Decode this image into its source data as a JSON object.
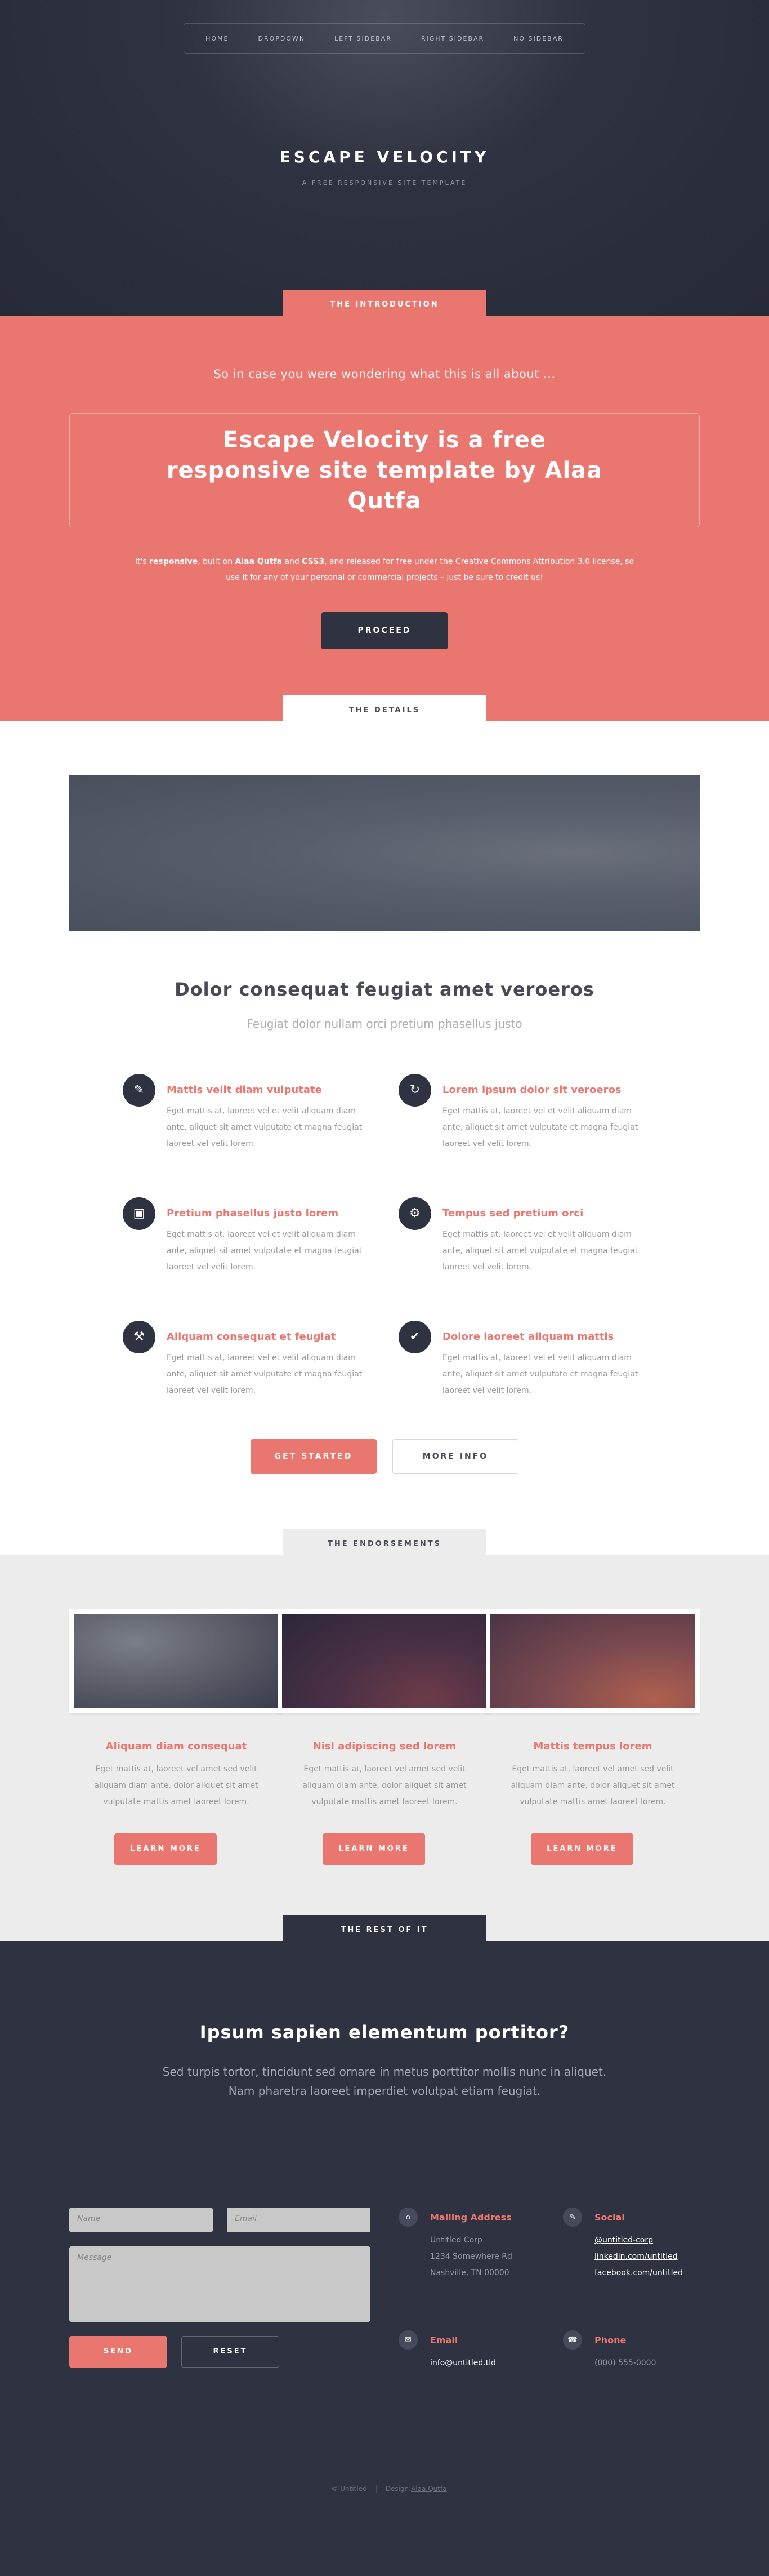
{
  "nav": {
    "items": [
      "HOME",
      "DROPDOWN",
      "LEFT SIDEBAR",
      "RIGHT SIDEBAR",
      "NO SIDEBAR"
    ]
  },
  "header": {
    "title": "ESCAPE VELOCITY",
    "tagline": "A FREE RESPONSIVE SITE TEMPLATE"
  },
  "intro": {
    "tab": "THE INTRODUCTION",
    "lead": "So in case you were wondering what this is all about ...",
    "headline": "Escape Velocity is a free responsive site template by Alaa Qutfa",
    "text": {
      "p1": "It's ",
      "b1": "responsive",
      "p2": ", built on ",
      "b2": "Alaa Qutfa",
      "p3": " and ",
      "b3": "CSS3",
      "p4": ", and released for free under the ",
      "link": "Creative Commons Attribution 3.0 license",
      "p5": ", so use it for any of your personal or commercial projects – just be sure to credit us!"
    },
    "button": "PROCEED"
  },
  "details": {
    "tab": "THE DETAILS",
    "title": "Dolor consequat feugiat amet veroeros",
    "subtitle": "Feugiat dolor nullam orci pretium phasellus justo",
    "features": [
      {
        "icon": "comment-icon",
        "title": "Mattis velit diam vulputate",
        "text": "Eget mattis at, laoreet vel et velit aliquam diam ante, aliquet sit amet vulputate et magna feugiat laoreet vel velit lorem."
      },
      {
        "icon": "refresh-icon",
        "title": "Lorem ipsum dolor sit veroeros",
        "text": "Eget mattis at, laoreet vel et velit aliquam diam ante, aliquet sit amet vulputate et magna feugiat laoreet vel velit lorem."
      },
      {
        "icon": "picture-icon",
        "title": "Pretium phasellus justo lorem",
        "text": "Eget mattis at, laoreet vel et velit aliquam diam ante, aliquet sit amet vulputate et magna feugiat laoreet vel velit lorem."
      },
      {
        "icon": "gear-icon",
        "title": "Tempus sed pretium orci",
        "text": "Eget mattis at, laoreet vel et velit aliquam diam ante, aliquet sit amet vulputate et magna feugiat laoreet vel velit lorem."
      },
      {
        "icon": "wrench-icon",
        "title": "Aliquam consequat et feugiat",
        "text": "Eget mattis at, laoreet vel et velit aliquam diam ante, aliquet sit amet vulputate et magna feugiat laoreet vel velit lorem."
      },
      {
        "icon": "check-icon",
        "title": "Dolore laoreet aliquam mattis",
        "text": "Eget mattis at, laoreet vel et velit aliquam diam ante, aliquet sit amet vulputate et magna feugiat laoreet vel velit lorem."
      }
    ],
    "btn_start": "GET STARTED",
    "btn_more": "MORE INFO"
  },
  "endorsements": {
    "tab": "THE ENDORSEMENTS",
    "cards": [
      {
        "title": "Aliquam diam consequat",
        "text": "Eget mattis at, laoreet vel amet sed velit aliquam diam ante, dolor aliquet sit amet vulputate mattis amet laoreet lorem.",
        "button": "LEARN MORE"
      },
      {
        "title": "Nisl adipiscing sed lorem",
        "text": "Eget mattis at, laoreet vel amet sed velit aliquam diam ante, dolor aliquet sit amet vulputate mattis amet laoreet lorem.",
        "button": "LEARN MORE"
      },
      {
        "title": "Mattis tempus lorem",
        "text": "Eget mattis at, laoreet vel amet sed velit aliquam diam ante, dolor aliquet sit amet vulputate mattis amet laoreet lorem.",
        "button": "LEARN MORE"
      }
    ]
  },
  "footer": {
    "tab": "THE REST OF IT",
    "title": "Ipsum sapien elementum portitor?",
    "text_line1": "Sed turpis tortor, tincidunt sed ornare in metus porttitor mollis nunc in aliquet.",
    "text_line2": "Nam pharetra laoreet imperdiet volutpat etiam feugiat.",
    "form": {
      "name_placeholder": "Name",
      "email_placeholder": "Email",
      "message_placeholder": "Message",
      "send": "SEND",
      "reset": "RESET"
    },
    "mailing": {
      "icon": "home-icon",
      "title": "Mailing Address",
      "lines": [
        "Untitled Corp",
        "1234 Somewhere Rd",
        "Nashville, TN 00000"
      ]
    },
    "social": {
      "icon": "comment-icon",
      "title": "Social",
      "lines": [
        "@untitled-corp",
        "linkedin.com/untitled",
        "facebook.com/untitled"
      ]
    },
    "email": {
      "icon": "envelope-icon",
      "title": "Email",
      "lines": [
        "info@untitled.tld"
      ]
    },
    "phone": {
      "icon": "phone-icon",
      "title": "Phone",
      "lines": [
        "(000) 555-0000"
      ]
    },
    "copyright": "© Untitled",
    "design_label": "Design: ",
    "design_link": "Alaa Qutfa"
  }
}
